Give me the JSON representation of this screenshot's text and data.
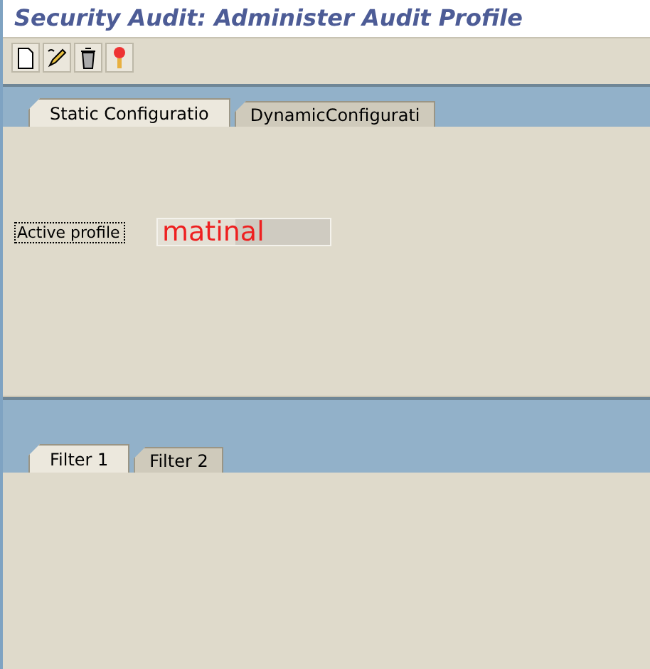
{
  "window": {
    "title": "Security Audit: Administer Audit Profile"
  },
  "toolbar": [
    {
      "kind": "new"
    },
    {
      "kind": "edit"
    },
    {
      "kind": "delete"
    },
    {
      "kind": "activate"
    }
  ],
  "tabs": [
    {
      "label": "Static Configuratio",
      "selected": true
    },
    {
      "label": "DynamicConfigurati",
      "selected": false
    }
  ],
  "active_profile": {
    "label": "Active profile",
    "value": "matinal"
  },
  "filter_tabs": [
    {
      "label": "Filter 1",
      "selected": true
    },
    {
      "label": "Filter 2",
      "selected": false
    }
  ]
}
